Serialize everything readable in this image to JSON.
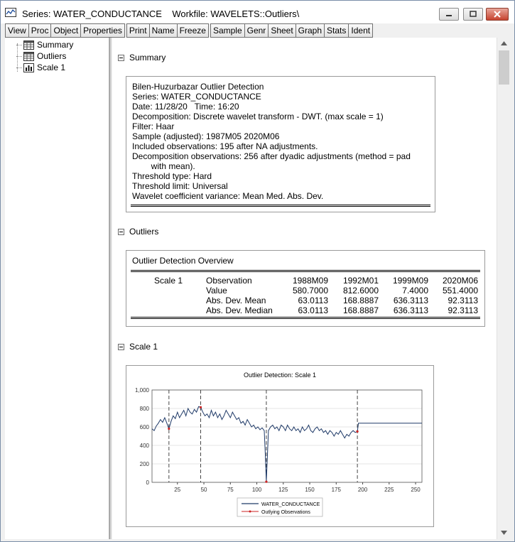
{
  "window": {
    "title": "Series: WATER_CONDUCTANCE    Workfile: WAVELETS::Outliers\\"
  },
  "toolbar": {
    "groups": [
      [
        "View",
        "Proc",
        "Object",
        "Properties"
      ],
      [
        "Print",
        "Name",
        "Freeze"
      ],
      [
        "Sample",
        "Genr",
        "Sheet",
        "Graph",
        "Stats",
        "Ident"
      ]
    ]
  },
  "sidebar": {
    "items": [
      {
        "label": "Summary",
        "icon": "table-icon"
      },
      {
        "label": "Outliers",
        "icon": "table-icon"
      },
      {
        "label": "Scale 1",
        "icon": "graph-icon"
      }
    ]
  },
  "summary": {
    "heading": "Summary",
    "lines": [
      "Bilen-Huzurbazar Outlier Detection",
      "Series: WATER_CONDUCTANCE",
      "Date: 11/28/20   Time: 16:20",
      "Decomposition: Discrete wavelet transform - DWT. (max scale = 1)",
      "Filter: Haar",
      "Sample (adjusted): 1987M05 2020M06",
      "Included observations: 195 after NA adjustments.",
      "Decomposition observations: 256 after dyadic adjustments (method = pad",
      "        with mean).",
      "Threshold type: Hard",
      "Threshold limit: Universal",
      "Wavelet coefficient variance: Mean Med. Abs. Dev."
    ]
  },
  "outliers": {
    "heading": "Outliers",
    "table_title": "Outlier Detection Overview",
    "scale_label": "Scale 1",
    "columns": [
      "Observation",
      "1988M09",
      "1992M01",
      "1999M09",
      "2020M06"
    ],
    "rows": [
      [
        "Value",
        "580.7000",
        "812.6000",
        "7.4000",
        "551.4000"
      ],
      [
        "Abs. Dev. Mean",
        "63.0113",
        "168.8887",
        "636.3113",
        "92.3113"
      ],
      [
        "Abs. Dev. Median",
        "63.0113",
        "168.8887",
        "636.3113",
        "92.3113"
      ]
    ]
  },
  "scale1": {
    "heading": "Scale 1"
  },
  "chart_data": {
    "type": "line",
    "title": "Outlier Detection: Scale 1",
    "xlim": [
      1,
      256
    ],
    "ylim": [
      0,
      1000
    ],
    "x_ticks": [
      "25",
      "50",
      "75",
      "100",
      "125",
      "150",
      "175",
      "200",
      "225",
      "250"
    ],
    "y_ticks": [
      "0",
      "200",
      "400",
      "600",
      "800",
      "1,000"
    ],
    "outlier_x": [
      17,
      47,
      109,
      195
    ],
    "series": [
      {
        "name": "WATER_CONDUCTANCE",
        "color": "#1f3a68",
        "x": [
          1,
          3,
          5,
          7,
          9,
          11,
          13,
          15,
          17,
          19,
          21,
          23,
          25,
          27,
          29,
          31,
          33,
          35,
          37,
          39,
          41,
          43,
          45,
          47,
          49,
          51,
          53,
          55,
          57,
          59,
          61,
          63,
          65,
          67,
          69,
          71,
          73,
          75,
          77,
          79,
          81,
          83,
          85,
          87,
          89,
          91,
          93,
          95,
          97,
          99,
          101,
          103,
          105,
          107,
          108,
          109,
          110,
          111,
          113,
          115,
          117,
          119,
          121,
          123,
          125,
          127,
          129,
          131,
          133,
          135,
          137,
          139,
          141,
          143,
          145,
          147,
          149,
          151,
          153,
          155,
          157,
          159,
          161,
          163,
          165,
          167,
          169,
          171,
          173,
          175,
          177,
          179,
          181,
          183,
          185,
          187,
          189,
          191,
          193,
          195,
          196,
          256
        ],
        "values": [
          580,
          560,
          610,
          640,
          680,
          650,
          700,
          640,
          581,
          660,
          720,
          690,
          760,
          700,
          740,
          780,
          720,
          800,
          760,
          740,
          790,
          760,
          820,
          813,
          760,
          720,
          740,
          700,
          780,
          720,
          760,
          700,
          740,
          680,
          720,
          780,
          740,
          700,
          760,
          720,
          680,
          700,
          640,
          660,
          620,
          680,
          640,
          600,
          620,
          580,
          600,
          570,
          590,
          560,
          300,
          7,
          280,
          560,
          600,
          620,
          580,
          600,
          560,
          620,
          600,
          560,
          620,
          580,
          560,
          600,
          560,
          580,
          540,
          600,
          560,
          580,
          620,
          560,
          540,
          580,
          600,
          560,
          580,
          540,
          560,
          520,
          560,
          540,
          500,
          540,
          520,
          560,
          520,
          480,
          520,
          500,
          540,
          560,
          540,
          551,
          640,
          640
        ]
      }
    ],
    "legend": [
      "WATER_CONDUCTANCE",
      "Outlying Observations"
    ],
    "outlier_color": "#cc2222"
  }
}
